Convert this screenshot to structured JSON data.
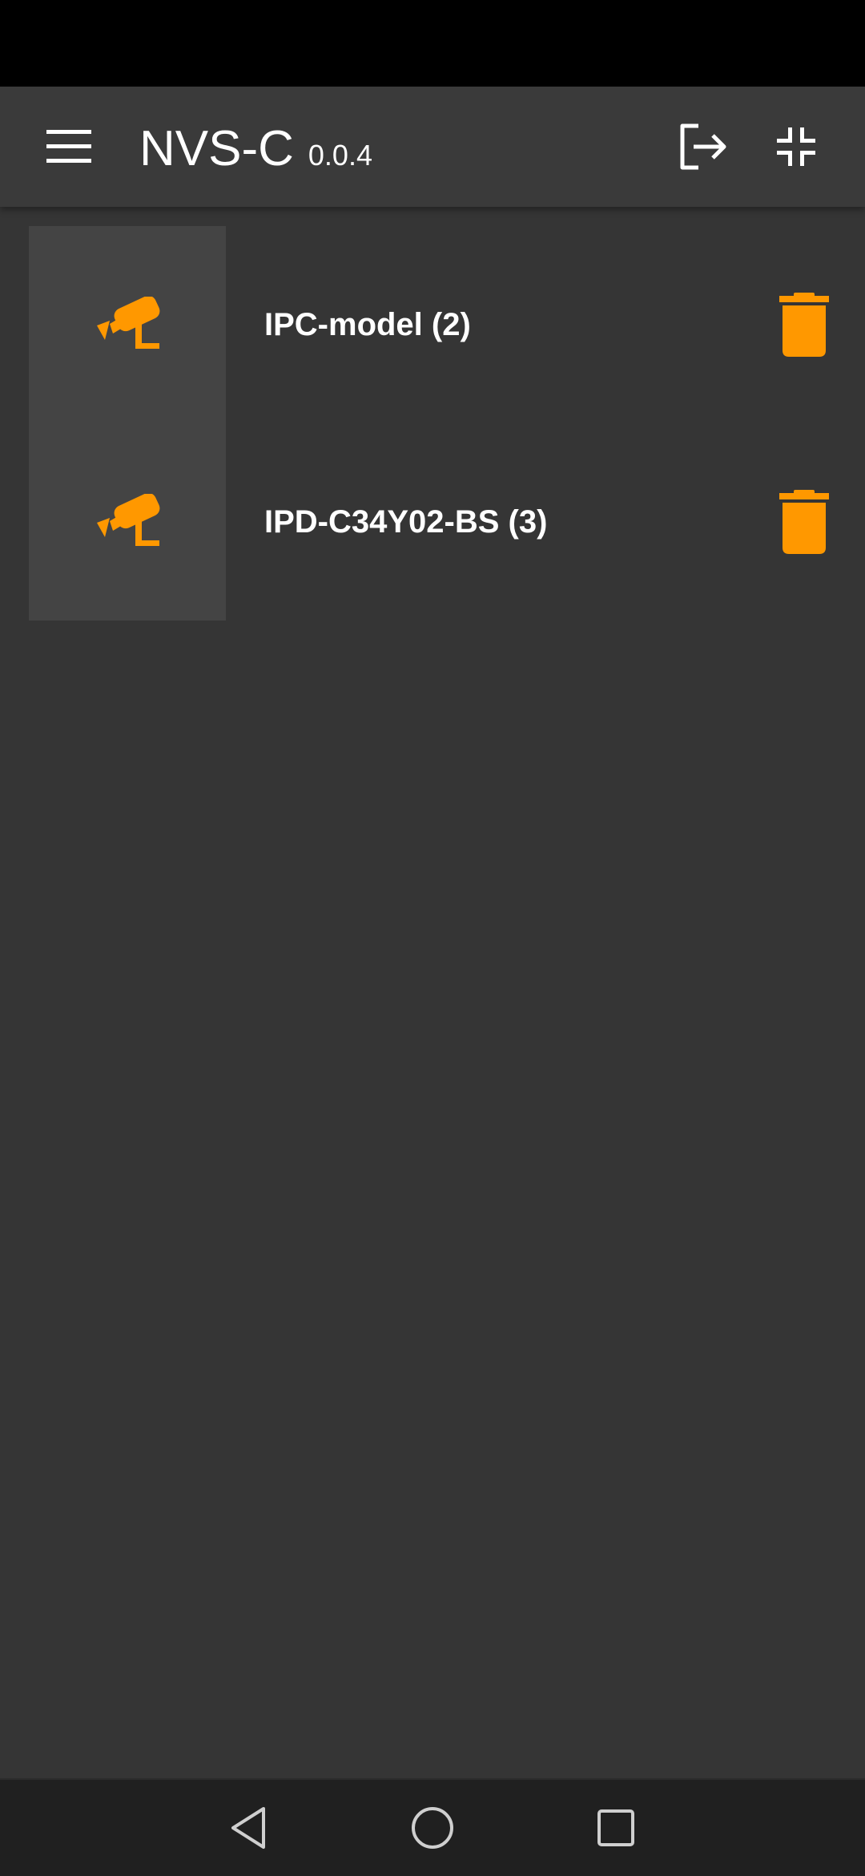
{
  "app": {
    "name": "NVS-C",
    "version": "0.0.4"
  },
  "colors": {
    "accent": "#FF9800",
    "appbar": "#3a3a3a",
    "background": "#353535",
    "thumbnail": "#444444"
  },
  "toolbar": {
    "menu_icon": "menu-icon",
    "logout_icon": "logout-icon",
    "fullscreen_exit_icon": "fullscreen-exit-icon"
  },
  "devices": [
    {
      "name": "IPC-model (2)",
      "icon": "security-camera-icon",
      "action_icon": "trash-icon"
    },
    {
      "name": "IPD-C34Y02-BS (3)",
      "icon": "security-camera-icon",
      "action_icon": "trash-icon"
    }
  ],
  "system_nav": {
    "back_icon": "back-icon",
    "home_icon": "home-icon",
    "recents_icon": "recents-icon"
  }
}
